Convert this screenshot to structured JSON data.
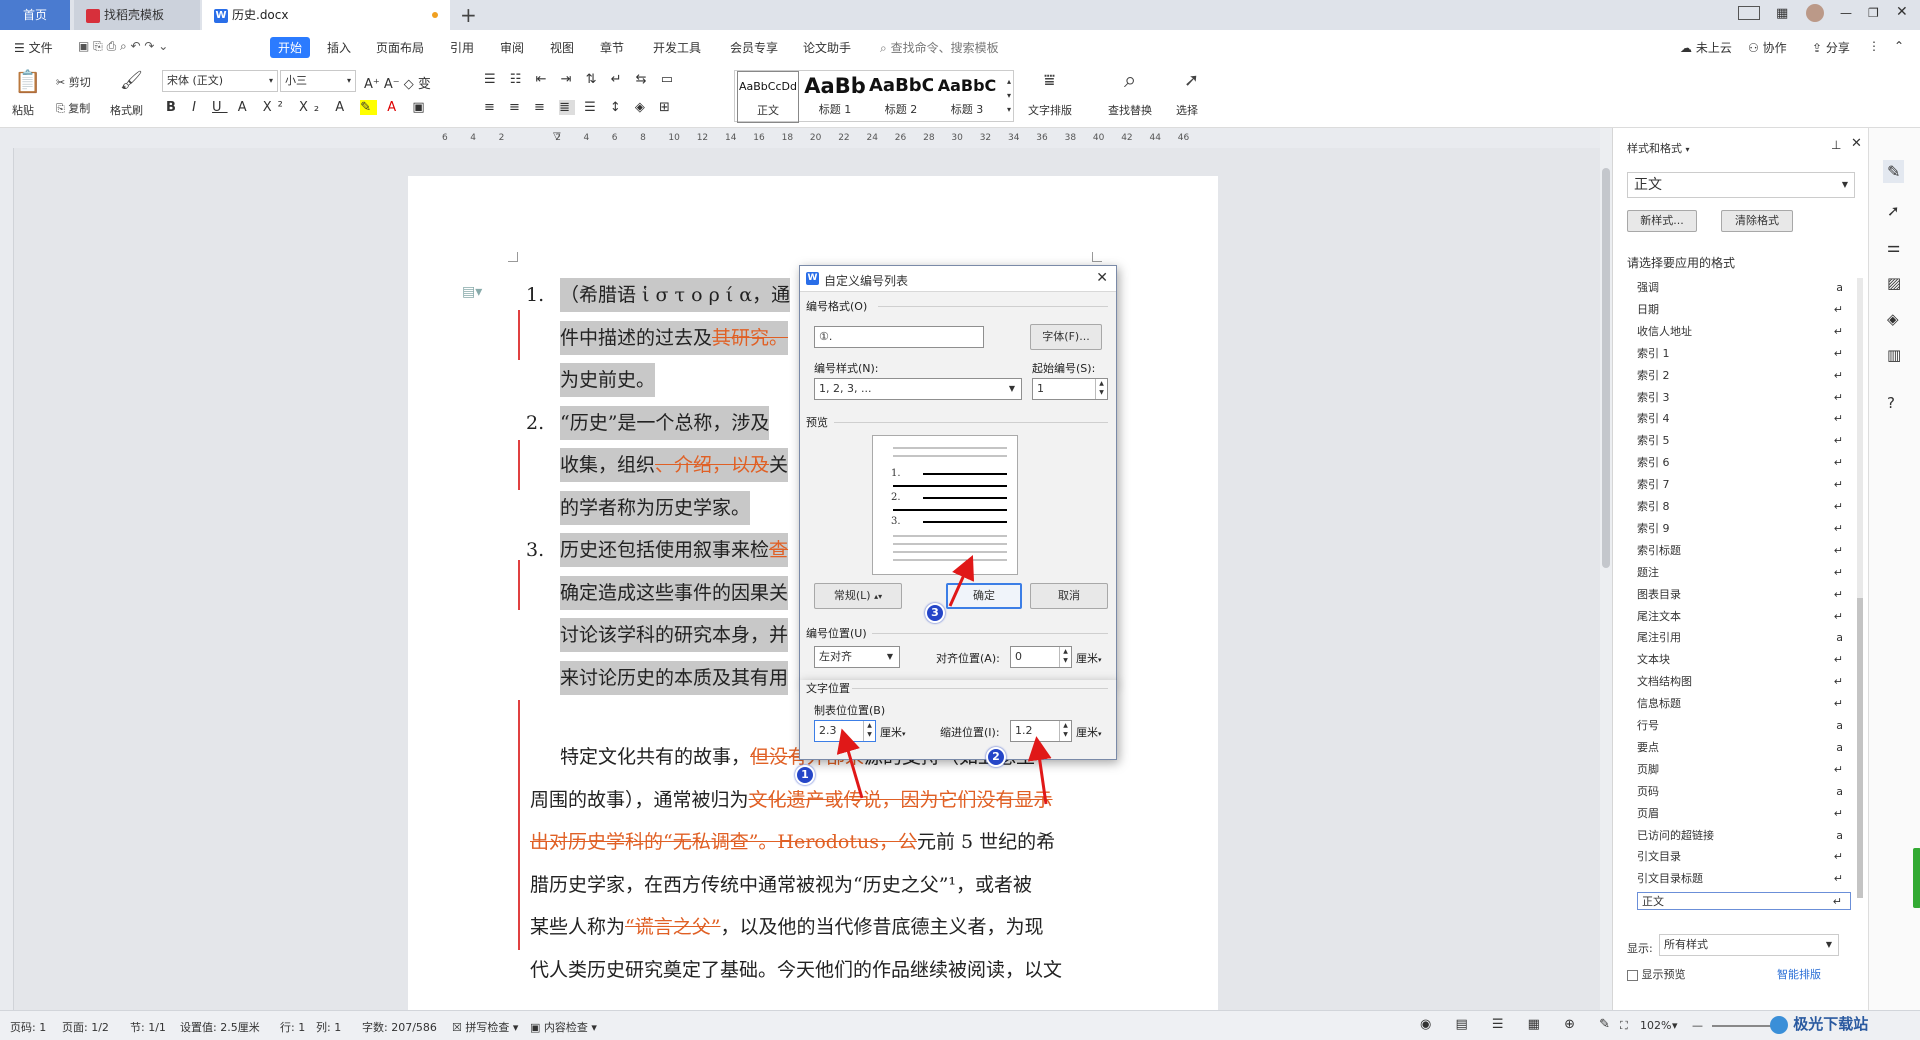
{
  "tabs": {
    "home": "首页",
    "template": "找稻壳模板",
    "document": "历史.docx",
    "add": "+"
  },
  "menu": {
    "file": "文件",
    "items": [
      "开始",
      "插入",
      "页面布局",
      "引用",
      "审阅",
      "视图",
      "章节",
      "开发工具",
      "会员专享",
      "论文助手"
    ],
    "search_placeholder": "查找命令、搜索模板",
    "cloud": "未上云",
    "collab": "协作",
    "share": "分享"
  },
  "ribbon": {
    "paste": "粘贴",
    "cut": "剪切",
    "copy": "复制",
    "format_painter": "格式刷",
    "font_name": "宋体 (正文)",
    "font_size": "小三",
    "styles": [
      {
        "preview": "AaBbCcDd",
        "name": "正文"
      },
      {
        "preview": "AaBb",
        "name": "标题 1"
      },
      {
        "preview": "AaBbC",
        "name": "标题 2"
      },
      {
        "preview": "AaBbC",
        "name": "标题 3"
      }
    ],
    "text_layout": "文字排版",
    "find_replace": "查找替换",
    "select": "选择"
  },
  "ruler_ticks": [
    "6",
    "4",
    "2",
    "",
    "2",
    "4",
    "6",
    "8",
    "10",
    "12",
    "14",
    "16",
    "18",
    "20",
    "22",
    "24",
    "26",
    "28",
    "30",
    "32",
    "34",
    "36",
    "38",
    "40",
    "42",
    "44",
    "46"
  ],
  "document": {
    "lines": [
      {
        "num": "1.",
        "text": "（希腊语 ἱ σ τ ο ρ ί α，通",
        "sel": true
      },
      {
        "num": "",
        "text": "件中描述的过去及",
        "strike": "其研究。",
        "sel": true
      },
      {
        "num": "",
        "text": "为史前史。",
        "sel": true
      },
      {
        "num": "2.",
        "text": "“历史”是一个总称，涉及",
        "sel": true
      },
      {
        "num": "",
        "text": "收集，组织",
        "strike": "、介绍，以及",
        "tail": "关",
        "sel": true
      },
      {
        "num": "",
        "text": "的学者称为历史学家。",
        "sel": true
      },
      {
        "num": "3.",
        "text": "历史还包括使用叙事来检",
        "strike": "查",
        "sel": true
      },
      {
        "num": "",
        "text": "确定造成这些事件的因果关",
        "sel": true
      },
      {
        "num": "",
        "text": "讨论该学科的研究本身，并",
        "sel": true
      },
      {
        "num": "",
        "text": "来讨论历史的本质及其有用",
        "sel": true
      }
    ],
    "para2": [
      {
        "pre": "特定文化共有的故事，",
        "strike": "但没有外部来",
        "post": "源的支持（如亚瑟王"
      },
      {
        "pre": "周围的故事），通常被归为",
        "strike": "文化遗产或传说，因为它们没有显示",
        "post": ""
      },
      {
        "pre": "",
        "strike": "出对历史学科的“无私调查”。Herodotus，公",
        "post": "元前 5 世纪的希"
      },
      {
        "pre": "腊历史学家，在西方传统中通常被视为“历史之父”¹，或者被",
        "strike": "",
        "post": ""
      },
      {
        "pre": "某些人称为",
        "strike": "“谎言之父”",
        "post": "，以及他的当代修昔底德主义者，为现"
      },
      {
        "pre": "代人类历史研究奠定了基础。今天他们的作品继续被阅读，以文",
        "strike": "",
        "post": ""
      }
    ]
  },
  "dialog": {
    "title": "自定义编号列表",
    "number_format_group": "编号格式(O)",
    "number_format_value": "①.",
    "font_button": "字体(F)...",
    "number_style_label": "编号样式(N):",
    "number_style_value": "1, 2, 3, ...",
    "start_at_label": "起始编号(S):",
    "start_at_value": "1",
    "preview_label": "预览",
    "preview_numbers": [
      "1.",
      "2.",
      "3."
    ],
    "normal_button": "常规(L)",
    "ok_button": "确定",
    "cancel_button": "取消",
    "number_position_group": "编号位置(U)",
    "align_value": "左对齐",
    "align_at_label": "对齐位置(A):",
    "align_at_value": "0",
    "unit": "厘米",
    "text_position_group": "文字位置",
    "tab_stop_label": "制表位位置(B)",
    "tab_stop_value": "2.3",
    "indent_label": "缩进位置(I):",
    "indent_value": "1.2",
    "badges": [
      "1",
      "2",
      "3"
    ]
  },
  "style_panel": {
    "title": "样式和格式",
    "current": "正文",
    "new_style": "新样式...",
    "clear_format": "清除格式",
    "prompt": "请选择要应用的格式",
    "items": [
      {
        "name": "强调",
        "mark": "a"
      },
      {
        "name": "日期",
        "mark": "↵"
      },
      {
        "name": "收信人地址",
        "mark": "↵"
      },
      {
        "name": "索引 1",
        "mark": "↵"
      },
      {
        "name": "索引 2",
        "mark": "↵"
      },
      {
        "name": "索引 3",
        "mark": "↵"
      },
      {
        "name": "索引 4",
        "mark": "↵"
      },
      {
        "name": "索引 5",
        "mark": "↵"
      },
      {
        "name": "索引 6",
        "mark": "↵"
      },
      {
        "name": "索引 7",
        "mark": "↵"
      },
      {
        "name": "索引 8",
        "mark": "↵"
      },
      {
        "name": "索引 9",
        "mark": "↵"
      },
      {
        "name": "索引标题",
        "mark": "↵"
      },
      {
        "name": "题注",
        "mark": "↵"
      },
      {
        "name": "图表目录",
        "mark": "↵"
      },
      {
        "name": "尾注文本",
        "mark": "↵"
      },
      {
        "name": "尾注引用",
        "mark": "a"
      },
      {
        "name": "文本块",
        "mark": "↵"
      },
      {
        "name": "文档结构图",
        "mark": "↵"
      },
      {
        "name": "信息标题",
        "mark": "↵"
      },
      {
        "name": "行号",
        "mark": "a"
      },
      {
        "name": "要点",
        "mark": "a"
      },
      {
        "name": "页脚",
        "mark": "↵"
      },
      {
        "name": "页码",
        "mark": "a"
      },
      {
        "name": "页眉",
        "mark": "↵"
      },
      {
        "name": "已访问的超链接",
        "mark": "a"
      },
      {
        "name": "引文目录",
        "mark": "↵"
      },
      {
        "name": "引文目录标题",
        "mark": "↵"
      },
      {
        "name": "正文",
        "mark": "↵"
      }
    ],
    "show_label": "显示:",
    "show_value": "所有样式",
    "show_preview": "显示预览",
    "smart_layout": "智能排版"
  },
  "status": {
    "page_no": "页码: 1",
    "pages": "页面: 1/2",
    "section": "节: 1/1",
    "setting": "设置值: 2.5厘米",
    "row": "行: 1",
    "col": "列: 1",
    "words": "字数: 207/586",
    "spell": "拼写检查",
    "content_check": "内容检查",
    "zoom": "102%"
  },
  "watermark": "极光下载站"
}
